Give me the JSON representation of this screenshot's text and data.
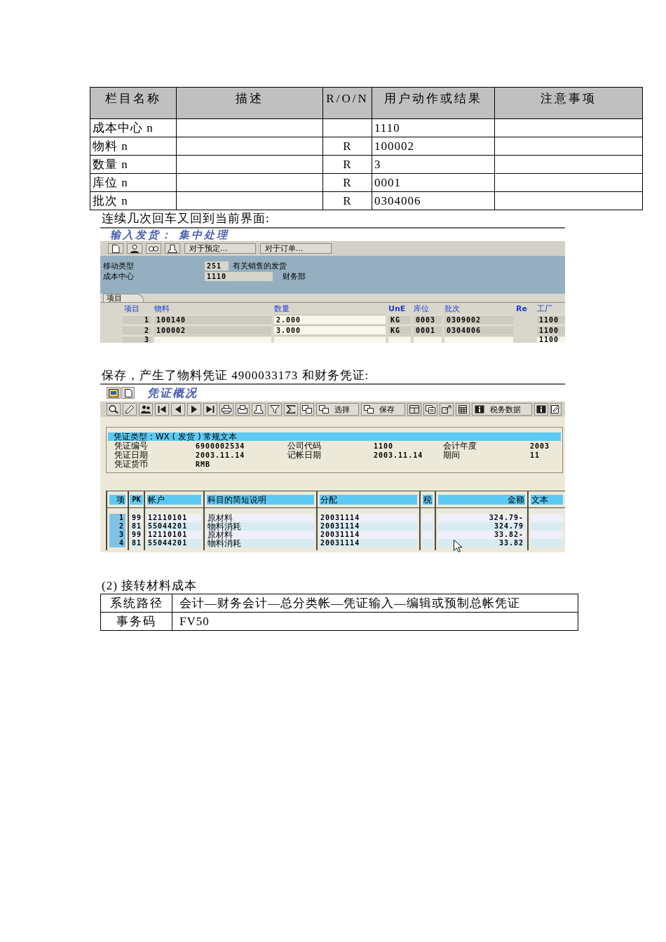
{
  "field_table": {
    "columns": [
      "栏目名称",
      "描述",
      "R/O/N",
      "用户动作或结果",
      "注意事项"
    ],
    "rows": [
      {
        "name": "成本中心 n",
        "result": "1110"
      },
      {
        "name": "物料 n",
        "ron": "R",
        "result": "100002"
      },
      {
        "name": "数量 n",
        "ron": "R",
        "result": "3"
      },
      {
        "name": "库位 n",
        "ron": "R",
        "result": "0001"
      },
      {
        "name": "批次 n",
        "ron": "R",
        "result": "0304006"
      }
    ]
  },
  "intro_1": "连续几次回车又回到当前界面:",
  "goods_issue_screen": {
    "title": "输入发货： 集中处理",
    "toolbar_buttons": [
      "对于预定...",
      "对于订单..."
    ],
    "fields": [
      {
        "label": "移动类型",
        "value": "251",
        "description": "有关销售的发货"
      },
      {
        "label": "成本中心",
        "value": "1110",
        "description": "财务部"
      }
    ],
    "tab": "项目",
    "table": {
      "columns": [
        "项目",
        "物料",
        "数量",
        "UnE",
        "库位",
        "批次",
        "Re",
        "工厂"
      ],
      "rows": [
        {
          "kind": "filled",
          "item": "1",
          "material": "100140",
          "quantity": "2.000",
          "unit": "KG",
          "location": "0003",
          "batch": "0309002",
          "plant": "1100"
        },
        {
          "kind": "filled",
          "item": "2",
          "material": "100002",
          "quantity": "3.000",
          "unit": "KG",
          "location": "0001",
          "batch": "0304006",
          "plant": "1100"
        },
        {
          "kind": "blank",
          "item": "3",
          "plant": "1100"
        }
      ]
    }
  },
  "intro_2": "保存，产生了物料凭证 4900033173 和财务凭证:",
  "document_overview_screen": {
    "title": "凭证概况",
    "toolbar_buttons": [
      "选择",
      "保存",
      "税务数据"
    ],
    "document_type": "凭证类型 : WX ( 发货 ) 常规文本",
    "fields": [
      {
        "label": "凭证编号",
        "value": "6900002534"
      },
      {
        "label": "公司代码",
        "value": "1100"
      },
      {
        "label": "会计年度",
        "value": "2003"
      },
      {
        "label": "凭证日期",
        "value": "2003.11.14"
      },
      {
        "label": "记帐日期",
        "value": "2003.11.14"
      },
      {
        "label": "期间",
        "value": "11"
      },
      {
        "label": "凭证货币",
        "value": "RMB"
      }
    ],
    "table": {
      "columns": [
        "项",
        "PK",
        "帐户",
        "科目的简短说明",
        "分配",
        "税",
        "金额",
        "文本"
      ],
      "rows": [
        {
          "item": "1",
          "pk": "99",
          "account": "12110101",
          "description": "原材料",
          "assignment": "20031114",
          "amount": "324.79-"
        },
        {
          "item": "2",
          "pk": "81",
          "account": "55044201",
          "description": "物料消耗",
          "assignment": "20031114",
          "amount": "324.79"
        },
        {
          "item": "3",
          "pk": "99",
          "account": "12110101",
          "description": "原材料",
          "assignment": "20031114",
          "amount": "33.82-"
        },
        {
          "item": "4",
          "pk": "81",
          "account": "55044201",
          "description": "物料消耗",
          "assignment": "20031114",
          "amount": "33.82"
        }
      ]
    }
  },
  "section_heading": "(2) 接转材料成本",
  "path_table": {
    "rows": [
      {
        "label": "系统路径",
        "value": "会计—财务会计—总分类帐—凭证输入—编辑或预制总帐凭证"
      },
      {
        "label": "事务码",
        "value": "FV50"
      }
    ]
  }
}
